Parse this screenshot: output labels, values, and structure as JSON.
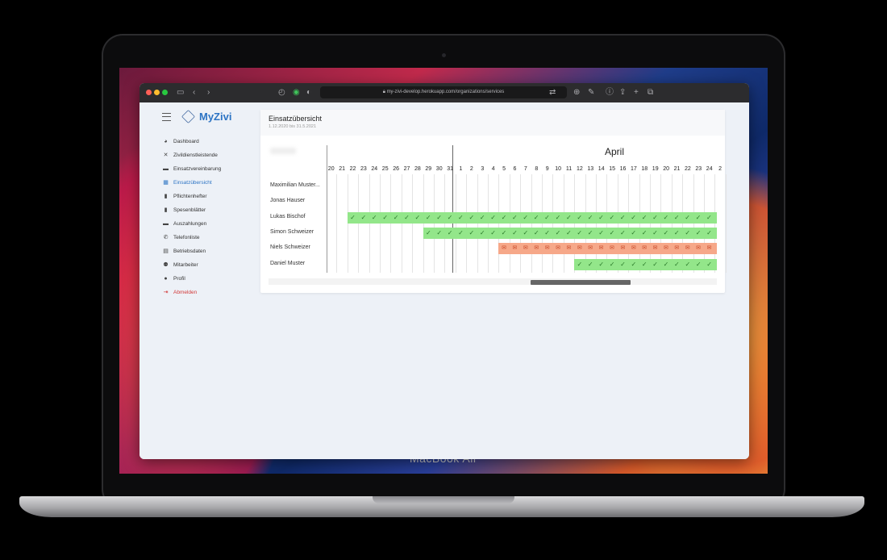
{
  "device": {
    "label": "MacBook Air"
  },
  "browser": {
    "url": "my-zivi-develop.herokuapp.com/organizations/services",
    "toolbar_icons": [
      "sidebar-icon",
      "back-icon",
      "forward-icon",
      "shield-icon",
      "extension-icon",
      "privacy-icon",
      "translate-icon",
      "download-icon",
      "share-icon",
      "new-tab-icon",
      "tabs-icon"
    ]
  },
  "app": {
    "brand": "MyZivi",
    "nav": [
      {
        "label": "Dashboard",
        "icon": "dashboard-icon",
        "glyph": "◕",
        "state": "normal"
      },
      {
        "label": "Zivildienstleistende",
        "icon": "tools-icon",
        "glyph": "✕",
        "state": "normal"
      },
      {
        "label": "Einsatzvereinbarung",
        "icon": "handshake-icon",
        "glyph": "▬",
        "state": "normal"
      },
      {
        "label": "Einsatzübersicht",
        "icon": "calendar-icon",
        "glyph": "▦",
        "state": "active"
      },
      {
        "label": "Pflichtenhefter",
        "icon": "document-icon",
        "glyph": "▮",
        "state": "normal"
      },
      {
        "label": "Spesenblätter",
        "icon": "document-icon",
        "glyph": "▮",
        "state": "normal"
      },
      {
        "label": "Auszahlungen",
        "icon": "folder-icon",
        "glyph": "▬",
        "state": "normal"
      },
      {
        "label": "Telefonliste",
        "icon": "phone-icon",
        "glyph": "✆",
        "state": "normal"
      },
      {
        "label": "Betriebsdaten",
        "icon": "building-icon",
        "glyph": "▤",
        "state": "normal"
      },
      {
        "label": "Mitarbeiter",
        "icon": "users-icon",
        "glyph": "⚉",
        "state": "normal"
      },
      {
        "label": "Profil",
        "icon": "user-icon",
        "glyph": "●",
        "state": "normal"
      },
      {
        "label": "Abmelden",
        "icon": "logout-icon",
        "glyph": "⇥",
        "state": "logout"
      }
    ]
  },
  "overview": {
    "title": "Einsatzübersicht",
    "range": "1.12.2020 bis 31.5.2021",
    "month": "April",
    "days": [
      "20",
      "21",
      "22",
      "23",
      "24",
      "25",
      "26",
      "27",
      "28",
      "29",
      "30",
      "31",
      "1",
      "2",
      "3",
      "4",
      "5",
      "6",
      "7",
      "8",
      "9",
      "10",
      "11",
      "12",
      "13",
      "14",
      "15",
      "16",
      "17",
      "18",
      "19",
      "20",
      "21",
      "22",
      "23",
      "24",
      "2"
    ],
    "people": [
      {
        "name": "Maximilian Muster...",
        "status": "none",
        "from": 0,
        "to": 0
      },
      {
        "name": "Jonas Hauser",
        "status": "none",
        "from": 0,
        "to": 0
      },
      {
        "name": "Lukas Bischof",
        "status": "approved",
        "from": 2,
        "to": 37
      },
      {
        "name": "Simon Schweizer",
        "status": "approved",
        "from": 9,
        "to": 37
      },
      {
        "name": "Niels Schweizer",
        "status": "pending",
        "from": 16,
        "to": 37
      },
      {
        "name": "Daniel Muster",
        "status": "approved",
        "from": 23,
        "to": 37
      }
    ],
    "approved_glyph": "✓",
    "pending_glyph": "✉",
    "colors": {
      "approved": "#93e68a",
      "pending": "#f6a889",
      "accent": "#2d74c4"
    }
  }
}
